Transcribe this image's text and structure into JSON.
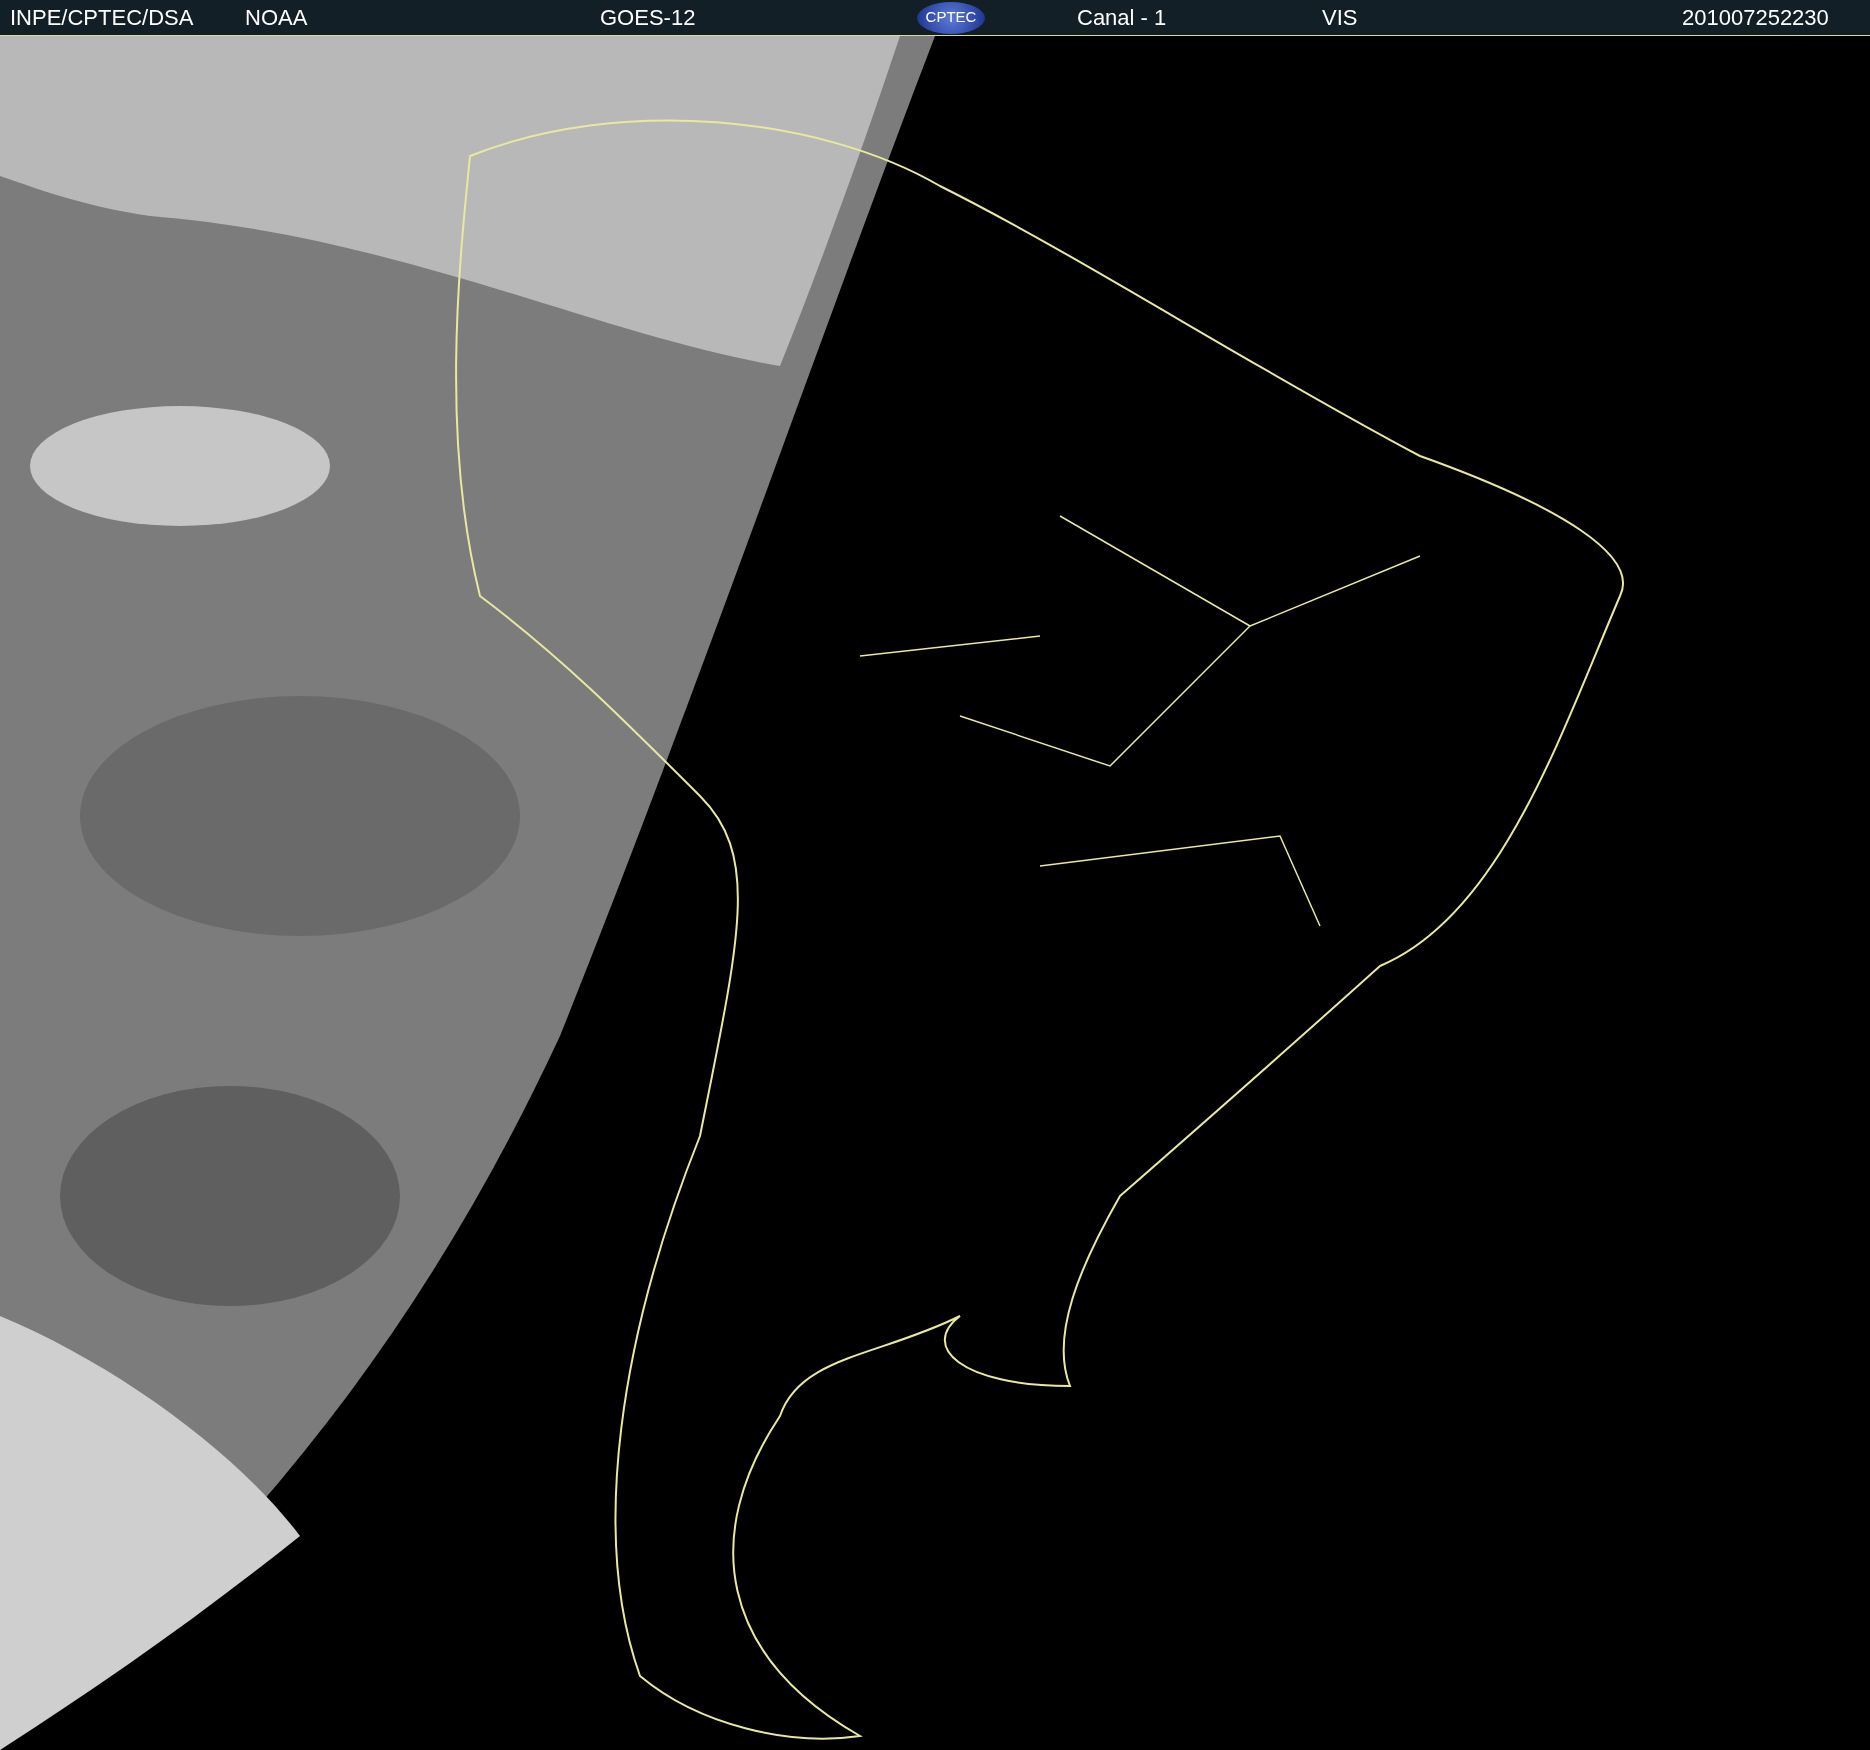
{
  "header": {
    "items": [
      "INPE/CPTEC/DSA",
      "NOAA",
      "GOES-12"
    ],
    "logo": "CPTEC",
    "channel": "Canal - 1",
    "band": "VIS",
    "timestamp": "201007252230"
  }
}
